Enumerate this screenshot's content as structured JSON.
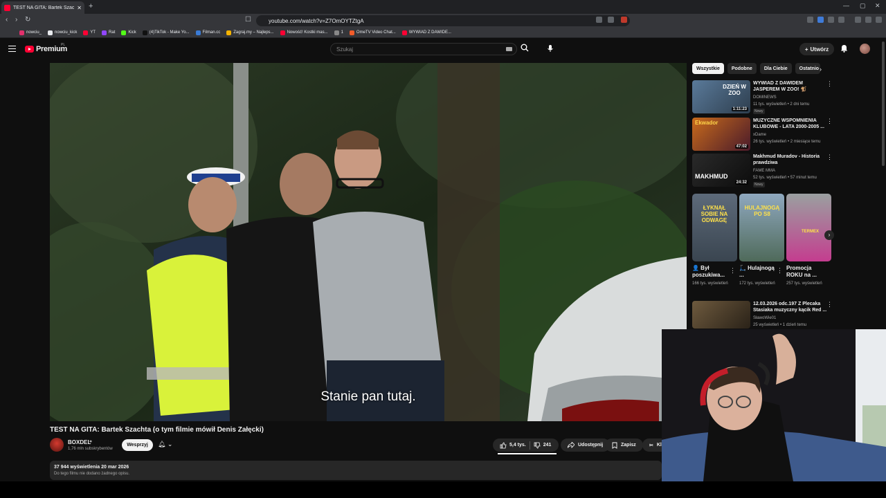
{
  "browser": {
    "tab_title": "TEST NA GITA: Bartek Szachta",
    "url": "youtube.com/watch?v=Z7OmOYTZtgA",
    "bookmarks": [
      "nowciu_",
      "nowciu_kick",
      "YT",
      "Rat",
      "Kick",
      "(4)TikTok - Make Yo...",
      "Filman.cc",
      "Zagraj.my – Najleps...",
      "Nowość! Kostki mas...",
      "1",
      "OmeTV Video Chat...",
      "WYWIAD Z DAWIDE..."
    ]
  },
  "header": {
    "logo_text": "Premium",
    "logo_country": "PL",
    "search_placeholder": "Szukaj",
    "create_label": "Utwórz"
  },
  "player": {
    "subtitle": "Stanie pan tutaj."
  },
  "video": {
    "title": "TEST NA GITA: Bartek Szachta (o tym filmie mówił Denis Załęcki)",
    "channel": "BOXDEL",
    "subscribers": "1,76 mln subskrybentów",
    "join_label": "Wesprzyj",
    "likes": "5,4 tys.",
    "dislikes": "241",
    "share_label": "Udostępnij",
    "save_label": "Zapisz",
    "clip_label": "Kl",
    "views_date": "37 944 wyświetlenia  20 mar 2026",
    "description": "Do tego filmu nie dodano żadnego opisu."
  },
  "sidebar": {
    "chips": [
      "Wszystkie",
      "Podobne",
      "Dla Ciebie",
      "Ostatnio"
    ],
    "recommendations": [
      {
        "title": "WYWIAD Z DAWIDEM JASPEREM W ZOO! 🐒",
        "channel": "DOMINEWS",
        "meta": "11 tys. wyświetleń • 2 dni temu",
        "badge": "Nowy",
        "duration": "1:11:23"
      },
      {
        "title": "MUZYCZNE WSPOMNIENIA KLUBOWE - LATA 2000-2005 ...",
        "channel": "xDame",
        "meta": "26 tys. wyświetleń • 2 miesiące temu",
        "badge": "",
        "duration": "47:02"
      },
      {
        "title": "Makhmud Muradov - Historia prawdziwa",
        "channel": "FAME MMA",
        "meta": "52 tys. wyświetleń • 57 minut temu",
        "badge": "Nowy",
        "duration": "24:32"
      },
      {
        "title": "12.03.2026 odc.197 Z Plecaka Stasiaka muzyczny kącik Red ...",
        "channel": "SławoWie01",
        "meta": "25 wyświetleń • 1 dzień temu",
        "badge": "",
        "duration": ""
      }
    ],
    "shorts": [
      {
        "title": "👤 Był poszukiwa...",
        "views": "166 tys. wyświetleń"
      },
      {
        "title": "🛴 Hulajnogą ...",
        "views": "172 tys. wyświetleń"
      },
      {
        "title": "Promocja ROKU na ...",
        "views": "257 tys. wyświetleń"
      }
    ],
    "thumb_texts": {
      "t1": "DZIEŃ W ZOO",
      "t2": "Ekwador",
      "t3": "MAKHMUD",
      "s1": "ŁYKNĄŁ SOBIE NA ODWAGĘ",
      "s2": "HULAJNOGĄ PO S8",
      "s3": "TERMEX"
    }
  }
}
